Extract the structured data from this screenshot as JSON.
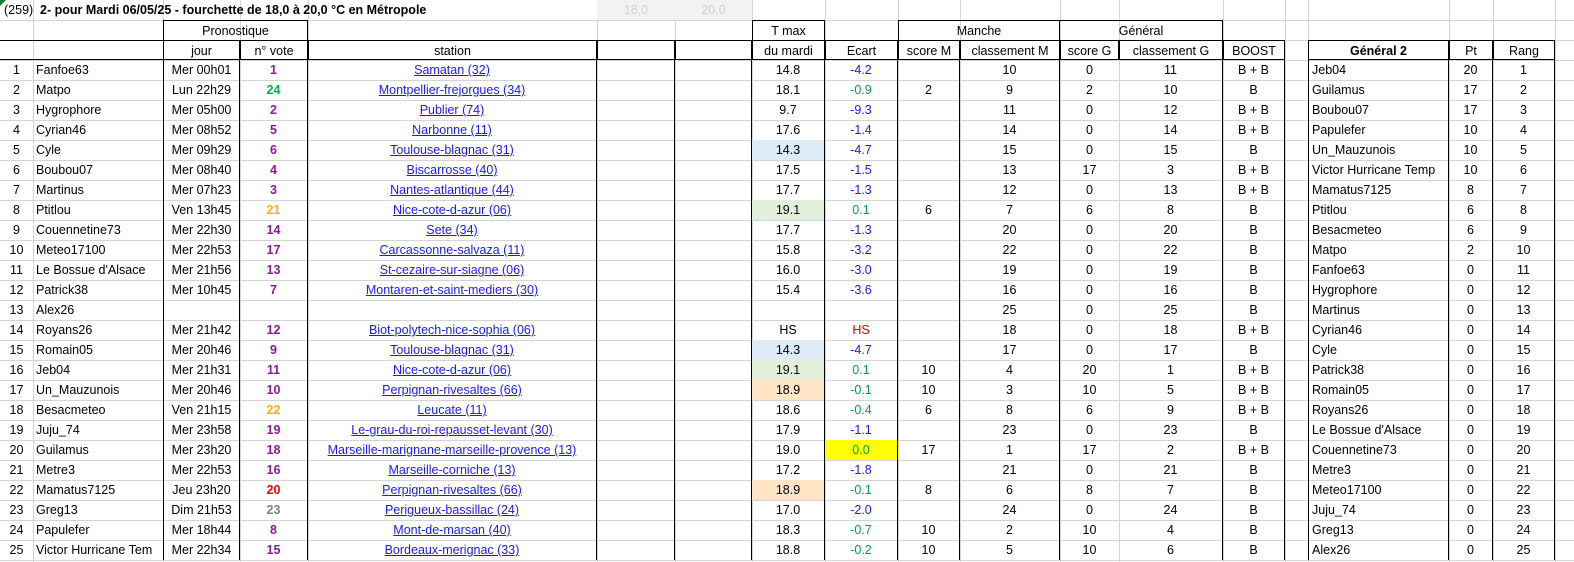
{
  "header": {
    "marker": "(259)",
    "title": "2- pour Mardi 06/05/25 - fourchette de 18,0 à 20,0 °C en Métropole",
    "range_low": "18,0",
    "range_high": "20,0",
    "group_pronostic": "Pronostique",
    "group_manche": "Manche",
    "group_general": "Général",
    "tmax_line1": "T max",
    "col_jour": "jour",
    "col_vote": "n° vote",
    "col_station": "station",
    "col_tmax": "du mardi",
    "col_ecart": "Ecart",
    "col_scoreM": "score M",
    "col_classM": "classement M",
    "col_scoreG": "score G",
    "col_classG": "classement G",
    "col_boost": "BOOST",
    "col_gen2": "Général 2",
    "col_pt": "Pt",
    "col_rang": "Rang"
  },
  "colors": {
    "vote_purple": "#8b1a9a",
    "vote_green": "#00b050",
    "vote_orange": "#ffb000",
    "vote_red": "#ff0000",
    "vote_gray": "#808080",
    "link_blue": "#1a1aff",
    "ecart_blue": "#1a1aff",
    "ecart_green": "#00a050",
    "hs_red": "#e00000",
    "hl_blue": "#ddebf7",
    "hl_green": "#e2efda",
    "hl_peach": "#fce4c4",
    "hl_yellow": "#ffff00"
  },
  "rows": [
    {
      "n": "1",
      "name": "Fanfoe63",
      "jour": "Mer 00h01",
      "vote": "1",
      "vc": "purple",
      "station": "Samatan (32)",
      "tmax": "14.8",
      "hl": "",
      "ecart": "-4.2",
      "ec": "neg",
      "scoreM": "",
      "classM": "10",
      "scoreG": "0",
      "classG": "11",
      "boost": "B + B",
      "g2": "Jeb04",
      "pt": "20",
      "rang": "1"
    },
    {
      "n": "2",
      "name": "Matpo",
      "jour": "Lun 22h29",
      "vote": "24",
      "vc": "green",
      "station": "Montpellier-frejorgues (34)",
      "tmax": "18.1",
      "hl": "",
      "ecart": "-0.9",
      "ec": "pos",
      "scoreM": "2",
      "classM": "9",
      "scoreG": "2",
      "classG": "10",
      "boost": "B",
      "g2": "Guilamus",
      "pt": "17",
      "rang": "2"
    },
    {
      "n": "3",
      "name": "Hygrophore",
      "jour": "Mer 05h00",
      "vote": "2",
      "vc": "purple",
      "station": "Publier (74)",
      "tmax": "9.7",
      "hl": "",
      "ecart": "-9.3",
      "ec": "neg",
      "scoreM": "",
      "classM": "11",
      "scoreG": "0",
      "classG": "12",
      "boost": "B + B",
      "g2": "Boubou07",
      "pt": "17",
      "rang": "3"
    },
    {
      "n": "4",
      "name": "Cyrian46",
      "jour": "Mer 08h52",
      "vote": "5",
      "vc": "purple",
      "station": "Narbonne (11)",
      "tmax": "17.6",
      "hl": "",
      "ecart": "-1.4",
      "ec": "neg",
      "scoreM": "",
      "classM": "14",
      "scoreG": "0",
      "classG": "14",
      "boost": "B + B",
      "g2": "Papulefer",
      "pt": "10",
      "rang": "4"
    },
    {
      "n": "5",
      "name": "Cyle",
      "jour": "Mer 09h29",
      "vote": "6",
      "vc": "purple",
      "station": "Toulouse-blagnac (31)",
      "tmax": "14.3",
      "hl": "blue",
      "ecart": "-4.7",
      "ec": "neg",
      "scoreM": "",
      "classM": "15",
      "scoreG": "0",
      "classG": "15",
      "boost": "B",
      "g2": "Un_Mauzunois",
      "pt": "10",
      "rang": "5"
    },
    {
      "n": "6",
      "name": "Boubou07",
      "jour": "Mer 08h40",
      "vote": "4",
      "vc": "purple",
      "station": "Biscarrosse (40)",
      "tmax": "17.5",
      "hl": "",
      "ecart": "-1.5",
      "ec": "neg",
      "scoreM": "",
      "classM": "13",
      "scoreG": "17",
      "classG": "3",
      "boost": "B + B",
      "g2": "Victor Hurricane Temp",
      "pt": "10",
      "rang": "6"
    },
    {
      "n": "7",
      "name": "Martinus",
      "jour": "Mer 07h23",
      "vote": "3",
      "vc": "purple",
      "station": "Nantes-atlantique (44)",
      "tmax": "17.7",
      "hl": "",
      "ecart": "-1.3",
      "ec": "neg",
      "scoreM": "",
      "classM": "12",
      "scoreG": "0",
      "classG": "13",
      "boost": "B + B",
      "g2": "Mamatus7125",
      "pt": "8",
      "rang": "7"
    },
    {
      "n": "8",
      "name": "Ptitlou",
      "jour": "Ven 13h45",
      "vote": "21",
      "vc": "orange",
      "station": "Nice-cote-d-azur (06)",
      "tmax": "19.1",
      "hl": "green",
      "ecart": "0.1",
      "ec": "pos",
      "scoreM": "6",
      "classM": "7",
      "scoreG": "6",
      "classG": "8",
      "boost": "B",
      "g2": "Ptitlou",
      "pt": "6",
      "rang": "8"
    },
    {
      "n": "9",
      "name": "Couennetine73",
      "jour": "Mer 22h30",
      "vote": "14",
      "vc": "purple",
      "station": "Sete (34)",
      "tmax": "17.7",
      "hl": "",
      "ecart": "-1.3",
      "ec": "neg",
      "scoreM": "",
      "classM": "20",
      "scoreG": "0",
      "classG": "20",
      "boost": "B",
      "g2": "Besacmeteo",
      "pt": "6",
      "rang": "9"
    },
    {
      "n": "10",
      "name": "Meteo17100",
      "jour": "Mer 22h53",
      "vote": "17",
      "vc": "purple",
      "station": "Carcassonne-salvaza (11)",
      "tmax": "15.8",
      "hl": "",
      "ecart": "-3.2",
      "ec": "neg",
      "scoreM": "",
      "classM": "22",
      "scoreG": "0",
      "classG": "22",
      "boost": "B",
      "g2": "Matpo",
      "pt": "2",
      "rang": "10"
    },
    {
      "n": "11",
      "name": "Le Bossue d'Alsace",
      "jour": "Mer 21h56",
      "vote": "13",
      "vc": "purple",
      "station": "St-cezaire-sur-siagne (06)",
      "tmax": "16.0",
      "hl": "",
      "ecart": "-3.0",
      "ec": "neg",
      "scoreM": "",
      "classM": "19",
      "scoreG": "0",
      "classG": "19",
      "boost": "B",
      "g2": "Fanfoe63",
      "pt": "0",
      "rang": "11"
    },
    {
      "n": "12",
      "name": "Patrick38",
      "jour": "Mer 10h45",
      "vote": "7",
      "vc": "purple",
      "station": "Montaren-et-saint-mediers (30)",
      "tmax": "15.4",
      "hl": "",
      "ecart": "-3.6",
      "ec": "neg",
      "scoreM": "",
      "classM": "16",
      "scoreG": "0",
      "classG": "16",
      "boost": "B",
      "g2": "Hygrophore",
      "pt": "0",
      "rang": "12"
    },
    {
      "n": "13",
      "name": "Alex26",
      "jour": "",
      "vote": "",
      "vc": "purple",
      "station": "",
      "tmax": "",
      "hl": "",
      "ecart": "",
      "ec": "neg",
      "scoreM": "",
      "classM": "25",
      "scoreG": "0",
      "classG": "25",
      "boost": "B",
      "g2": "Martinus",
      "pt": "0",
      "rang": "13"
    },
    {
      "n": "14",
      "name": "Royans26",
      "jour": "Mer 21h42",
      "vote": "12",
      "vc": "purple",
      "station": "Biot-polytech-nice-sophia (06)",
      "tmax": "HS",
      "hl": "",
      "ecart": "HS",
      "ec": "hs",
      "scoreM": "",
      "classM": "18",
      "scoreG": "0",
      "classG": "18",
      "boost": "B + B",
      "g2": "Cyrian46",
      "pt": "0",
      "rang": "14"
    },
    {
      "n": "15",
      "name": "Romain05",
      "jour": "Mer 20h46",
      "vote": "9",
      "vc": "purple",
      "station": "Toulouse-blagnac (31)",
      "tmax": "14.3",
      "hl": "blue",
      "ecart": "-4.7",
      "ec": "neg",
      "scoreM": "",
      "classM": "17",
      "scoreG": "0",
      "classG": "17",
      "boost": "B",
      "g2": "Cyle",
      "pt": "0",
      "rang": "15"
    },
    {
      "n": "16",
      "name": "Jeb04",
      "jour": "Mer 21h31",
      "vote": "11",
      "vc": "purple",
      "station": "Nice-cote-d-azur (06)",
      "tmax": "19.1",
      "hl": "green",
      "ecart": "0.1",
      "ec": "pos",
      "scoreM": "10",
      "classM": "4",
      "scoreG": "20",
      "classG": "1",
      "boost": "B + B",
      "g2": "Patrick38",
      "pt": "0",
      "rang": "16"
    },
    {
      "n": "17",
      "name": "Un_Mauzunois",
      "jour": "Mer 20h46",
      "vote": "10",
      "vc": "purple",
      "station": "Perpignan-rivesaltes (66)",
      "tmax": "18.9",
      "hl": "peach",
      "ecart": "-0.1",
      "ec": "pos",
      "scoreM": "10",
      "classM": "3",
      "scoreG": "10",
      "classG": "5",
      "boost": "B + B",
      "g2": "Romain05",
      "pt": "0",
      "rang": "17"
    },
    {
      "n": "18",
      "name": "Besacmeteo",
      "jour": "Ven 21h15",
      "vote": "22",
      "vc": "orange",
      "station": "Leucate (11)",
      "tmax": "18.6",
      "hl": "",
      "ecart": "-0.4",
      "ec": "pos",
      "scoreM": "6",
      "classM": "8",
      "scoreG": "6",
      "classG": "9",
      "boost": "B + B",
      "g2": "Royans26",
      "pt": "0",
      "rang": "18"
    },
    {
      "n": "19",
      "name": "Juju_74",
      "jour": "Mer 23h58",
      "vote": "19",
      "vc": "purple",
      "station": "Le-grau-du-roi-repausset-levant (30)",
      "tmax": "17.9",
      "hl": "",
      "ecart": "-1.1",
      "ec": "neg",
      "scoreM": "",
      "classM": "23",
      "scoreG": "0",
      "classG": "23",
      "boost": "B",
      "g2": "Le Bossue d'Alsace",
      "pt": "0",
      "rang": "19"
    },
    {
      "n": "20",
      "name": "Guilamus",
      "jour": "Mer 23h20",
      "vote": "18",
      "vc": "purple",
      "station": "Marseille-marignane-marseille-provence (13)",
      "tmax": "19.0",
      "hl": "",
      "ecart": "0.0",
      "ec": "pos",
      "ehl": "yellow",
      "scoreM": "17",
      "classM": "1",
      "scoreG": "17",
      "classG": "2",
      "boost": "B + B",
      "g2": "Couennetine73",
      "pt": "0",
      "rang": "20"
    },
    {
      "n": "21",
      "name": "Metre3",
      "jour": "Mer 22h53",
      "vote": "16",
      "vc": "purple",
      "station": "Marseille-corniche (13)",
      "tmax": "17.2",
      "hl": "",
      "ecart": "-1.8",
      "ec": "neg",
      "scoreM": "",
      "classM": "21",
      "scoreG": "0",
      "classG": "21",
      "boost": "B",
      "g2": "Metre3",
      "pt": "0",
      "rang": "21"
    },
    {
      "n": "22",
      "name": "Mamatus7125",
      "jour": "Jeu 23h20",
      "vote": "20",
      "vc": "red",
      "station": "Perpignan-rivesaltes (66)",
      "tmax": "18.9",
      "hl": "peach",
      "ecart": "-0.1",
      "ec": "pos",
      "scoreM": "8",
      "classM": "6",
      "scoreG": "8",
      "classG": "7",
      "boost": "B",
      "g2": "Meteo17100",
      "pt": "0",
      "rang": "22"
    },
    {
      "n": "23",
      "name": "Greg13",
      "jour": "Dim 21h53",
      "vote": "23",
      "vc": "gray",
      "station": "Perigueux-bassillac (24)",
      "tmax": "17.0",
      "hl": "",
      "ecart": "-2.0",
      "ec": "neg",
      "scoreM": "",
      "classM": "24",
      "scoreG": "0",
      "classG": "24",
      "boost": "B",
      "g2": "Juju_74",
      "pt": "0",
      "rang": "23"
    },
    {
      "n": "24",
      "name": "Papulefer",
      "jour": "Mer 18h44",
      "vote": "8",
      "vc": "purple",
      "station": "Mont-de-marsan (40)",
      "tmax": "18.3",
      "hl": "",
      "ecart": "-0.7",
      "ec": "pos",
      "scoreM": "10",
      "classM": "2",
      "scoreG": "10",
      "classG": "4",
      "boost": "B",
      "g2": "Greg13",
      "pt": "0",
      "rang": "24"
    },
    {
      "n": "25",
      "name": "Victor Hurricane Tem",
      "jour": "Mer 22h34",
      "vote": "15",
      "vc": "purple",
      "station": "Bordeaux-merignac (33)",
      "tmax": "18.8",
      "hl": "",
      "ecart": "-0.2",
      "ec": "pos",
      "scoreM": "10",
      "classM": "5",
      "scoreG": "10",
      "classG": "6",
      "boost": "B",
      "g2": "Alex26",
      "pt": "0",
      "rang": "25"
    }
  ]
}
